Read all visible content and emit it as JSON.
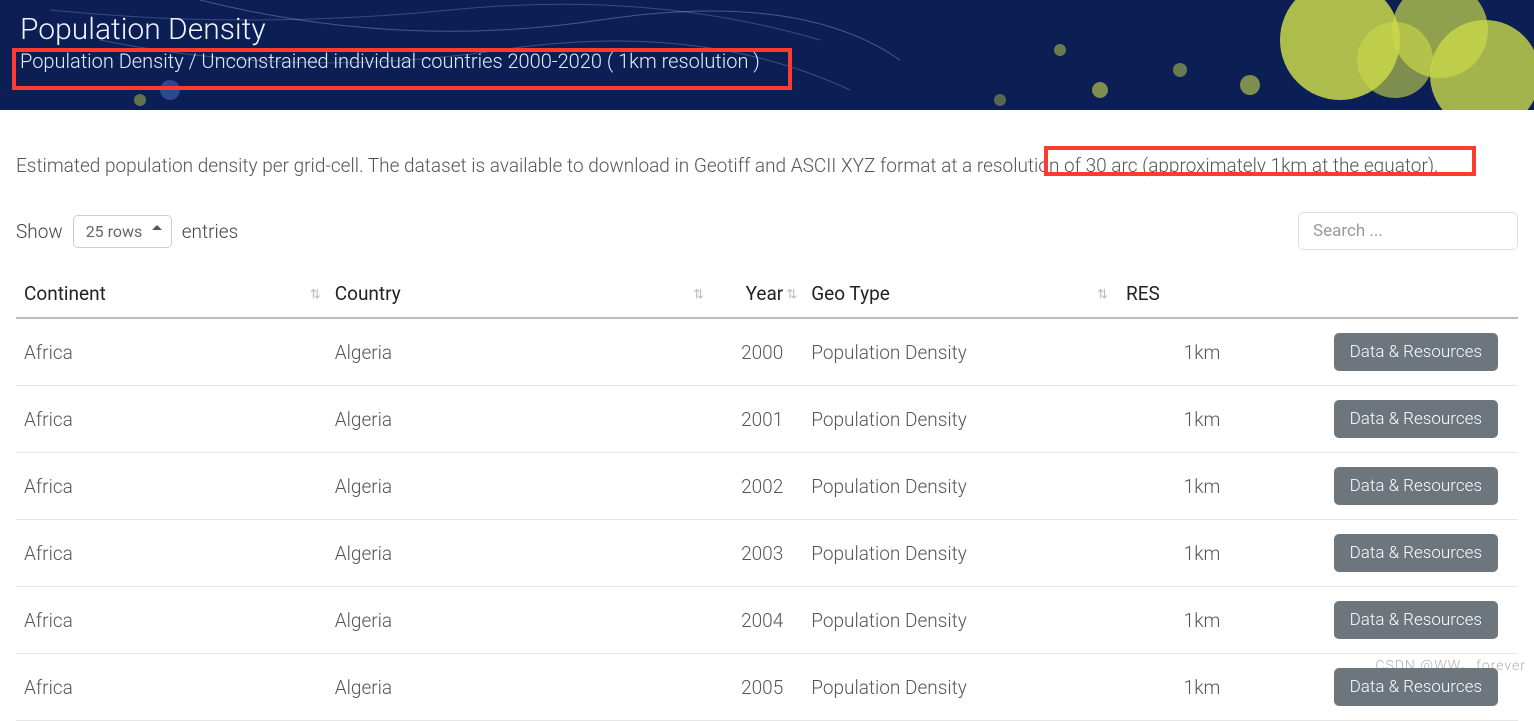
{
  "hero": {
    "title": "Population Density",
    "breadcrumb": "Population Density / Unconstrained individual countries 2000-2020 ( 1km resolution )"
  },
  "description": "Estimated population density per grid-cell. The dataset is available to download in Geotiff and ASCII XYZ format at a resolution of 30 arc (approximately 1km at the equator).",
  "controls": {
    "show_label": "Show",
    "rows_value": "25 rows",
    "entries_label": "entries",
    "search_placeholder": "Search ..."
  },
  "table": {
    "headers": {
      "continent": "Continent",
      "country": "Country",
      "year": "Year",
      "geo": "Geo Type",
      "res": "RES",
      "action": ""
    },
    "action_label": "Data & Resources",
    "rows": [
      {
        "continent": "Africa",
        "country": "Algeria",
        "year": "2000",
        "geo": "Population Density",
        "res": "1km"
      },
      {
        "continent": "Africa",
        "country": "Algeria",
        "year": "2001",
        "geo": "Population Density",
        "res": "1km"
      },
      {
        "continent": "Africa",
        "country": "Algeria",
        "year": "2002",
        "geo": "Population Density",
        "res": "1km"
      },
      {
        "continent": "Africa",
        "country": "Algeria",
        "year": "2003",
        "geo": "Population Density",
        "res": "1km"
      },
      {
        "continent": "Africa",
        "country": "Algeria",
        "year": "2004",
        "geo": "Population Density",
        "res": "1km"
      },
      {
        "continent": "Africa",
        "country": "Algeria",
        "year": "2005",
        "geo": "Population Density",
        "res": "1km"
      }
    ]
  },
  "watermark": "CSDN @WW、forever"
}
